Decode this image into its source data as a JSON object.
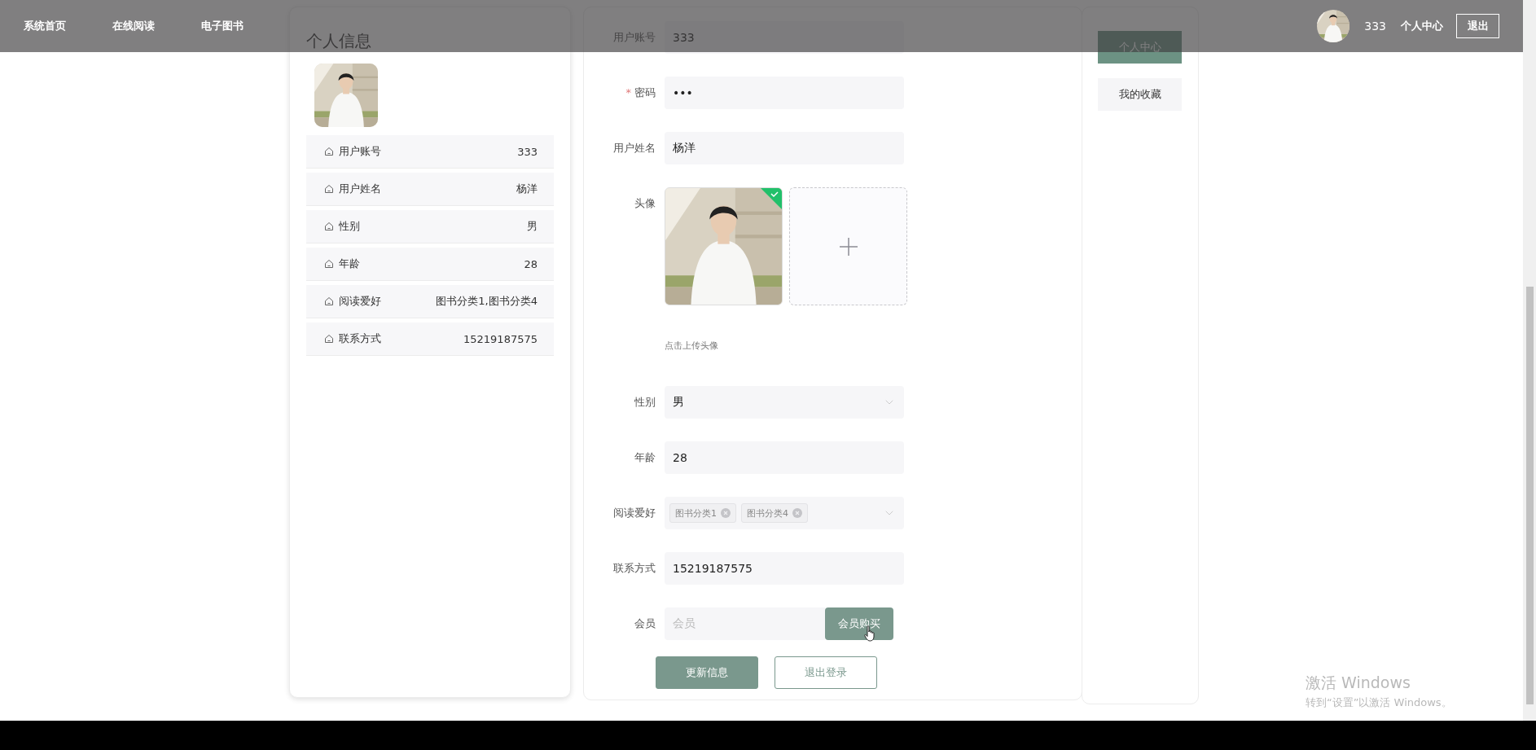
{
  "header": {
    "links": [
      {
        "label": "系统首页"
      },
      {
        "label": "在线阅读"
      },
      {
        "label": "电子图书"
      }
    ],
    "user": {
      "kind": "picture",
      "name": "333"
    },
    "center_link": "个人中心",
    "logout": "退出"
  },
  "profile": {
    "title": "个人信息",
    "rows": [
      {
        "label": "用户账号",
        "value": "333"
      },
      {
        "label": "用户姓名",
        "value": "杨洋"
      },
      {
        "label": "性别",
        "value": "男"
      },
      {
        "label": "年龄",
        "value": "28"
      },
      {
        "label": "阅读爱好",
        "value": "图书分类1,图书分类4"
      },
      {
        "label": "联系方式",
        "value": "15219187575"
      }
    ]
  },
  "form": {
    "fields": [
      {
        "kind": "text",
        "label": "用户账号",
        "value": "333"
      },
      {
        "kind": "text",
        "label": "密码",
        "required_mark": "*",
        "value": "•••"
      },
      {
        "kind": "text",
        "label": "用户姓名",
        "value": "杨洋"
      },
      {
        "kind": "upload",
        "label": "头像",
        "uploaded": true,
        "hint": "点击上传头像"
      },
      {
        "kind": "select",
        "label": "性别",
        "value": "男"
      },
      {
        "kind": "text",
        "label": "年龄",
        "value": "28"
      },
      {
        "kind": "tags",
        "label": "阅读爱好",
        "tags": [
          "图书分类1",
          "图书分类4"
        ]
      },
      {
        "kind": "text",
        "label": "联系方式",
        "value": "15219187575"
      },
      {
        "kind": "member",
        "label": "会员",
        "placeholder": "会员",
        "button": "会员购买"
      }
    ],
    "buttons": [
      {
        "label": "更新信息",
        "primary": true
      },
      {
        "label": "退出登录",
        "primary": false
      }
    ]
  },
  "side_menu": [
    {
      "label": "个人中心",
      "selected": true
    },
    {
      "label": "我的收藏",
      "selected": false
    }
  ],
  "os_notice": {
    "title": "激活 Windows",
    "text": "转到“设置”以激活 Windows。"
  }
}
